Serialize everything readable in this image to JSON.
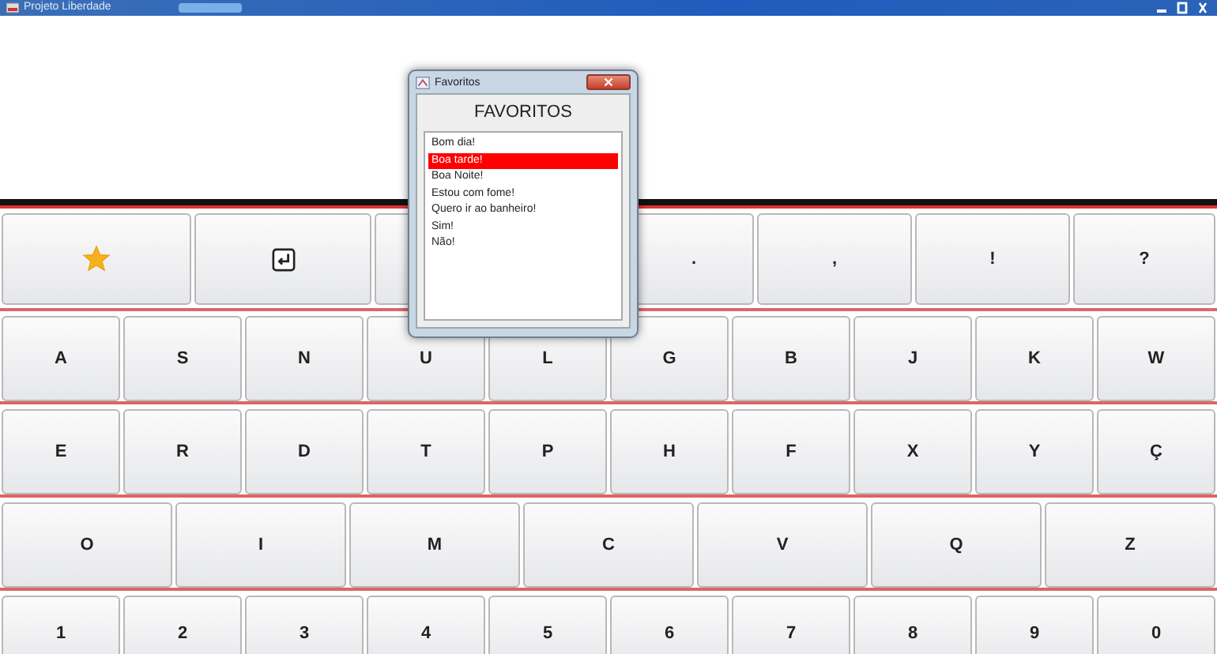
{
  "window": {
    "title": "Projeto Liberdade"
  },
  "top_keys": [
    {
      "kind": "star"
    },
    {
      "kind": "enter"
    },
    {
      "kind": "covered"
    },
    {
      "kind": "text",
      "label": "."
    },
    {
      "kind": "text",
      "label": ","
    },
    {
      "kind": "text",
      "label": "!"
    },
    {
      "kind": "text",
      "label": "?"
    }
  ],
  "key_rows": [
    [
      "A",
      "S",
      "N",
      "U",
      "L",
      "G",
      "B",
      "J",
      "K",
      "W"
    ],
    [
      "E",
      "R",
      "D",
      "T",
      "P",
      "H",
      "F",
      "X",
      "Y",
      "Ç"
    ],
    [
      "O",
      "I",
      "M",
      "C",
      "V",
      "Q",
      "Z"
    ],
    [
      "1",
      "2",
      "3",
      "4",
      "5",
      "6",
      "7",
      "8",
      "9",
      "0"
    ]
  ],
  "dialog": {
    "title": "Favoritos",
    "heading": "FAVORITOS",
    "items": [
      {
        "label": "Bom dia!",
        "selected": false
      },
      {
        "label": "Boa tarde!",
        "selected": true
      },
      {
        "label": "Boa Noite!",
        "selected": false
      },
      {
        "label": "Estou com fome!",
        "selected": false
      },
      {
        "label": "Quero ir ao banheiro!",
        "selected": false
      },
      {
        "label": "Sim!",
        "selected": false
      },
      {
        "label": "Não!",
        "selected": false
      }
    ]
  }
}
